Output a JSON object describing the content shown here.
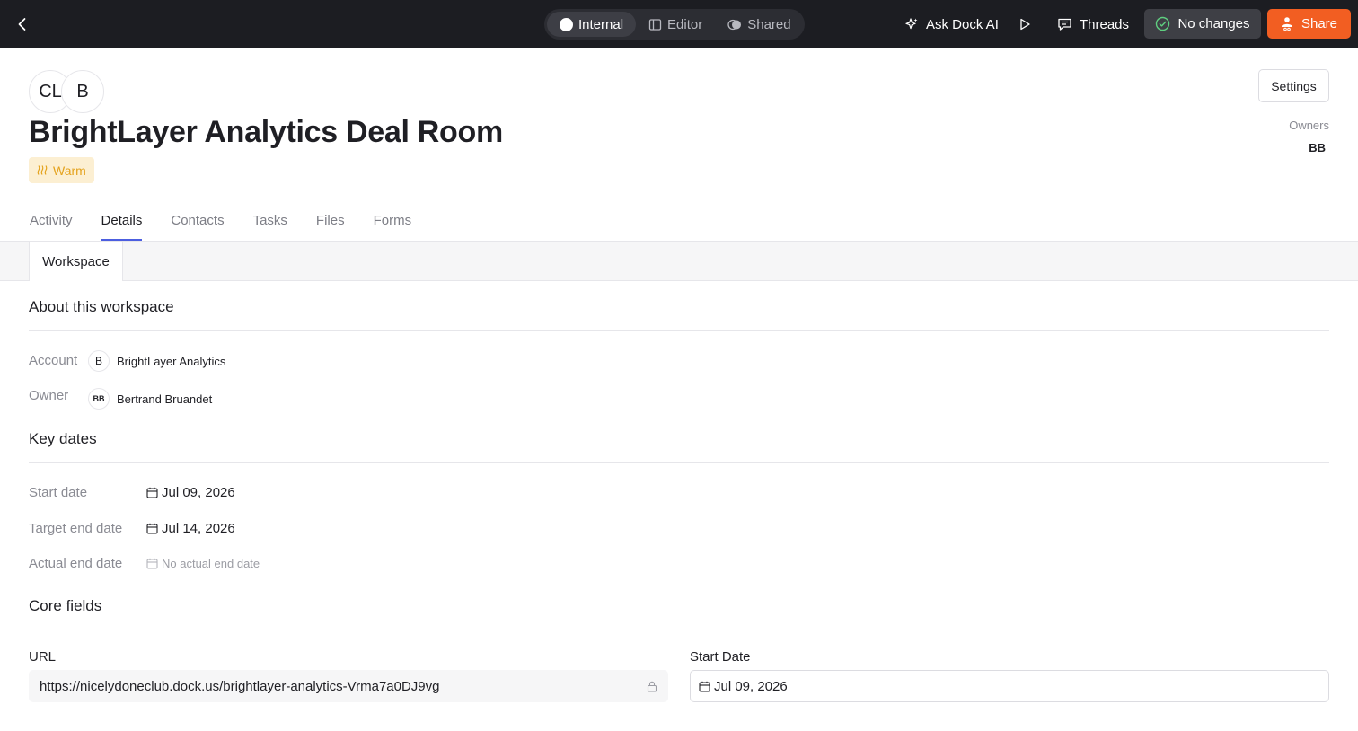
{
  "topbar": {
    "modes": [
      {
        "label": "Internal",
        "icon": "circle-dot-icon",
        "active": true
      },
      {
        "label": "Editor",
        "icon": "sidebar-panel-icon",
        "active": false
      },
      {
        "label": "Shared",
        "icon": "toggle-icon",
        "active": false
      }
    ],
    "ask_ai_label": "Ask Dock AI",
    "threads_label": "Threads",
    "no_changes_label": "No changes",
    "share_label": "Share",
    "colors": {
      "bar": "#1c1d22",
      "share": "#f25e22"
    }
  },
  "header": {
    "avatars": [
      "CL",
      "B"
    ],
    "title": "BrightLayer Analytics Deal Room",
    "status": "Warm",
    "status_color": "#e4a21c",
    "settings_label": "Settings",
    "owners_label": "Owners",
    "owners_initials": "BB"
  },
  "tabs": [
    {
      "label": "Activity",
      "active": false
    },
    {
      "label": "Details",
      "active": true
    },
    {
      "label": "Contacts",
      "active": false
    },
    {
      "label": "Tasks",
      "active": false
    },
    {
      "label": "Files",
      "active": false
    },
    {
      "label": "Forms",
      "active": false
    }
  ],
  "subtabs": [
    {
      "label": "Workspace",
      "active": true
    }
  ],
  "about": {
    "title": "About this workspace",
    "account_label": "Account",
    "account_avatar": "B",
    "account_value": "BrightLayer Analytics",
    "owner_label": "Owner",
    "owner_avatar": "BB",
    "owner_value": "Bertrand Bruandet"
  },
  "key_dates": {
    "title": "Key dates",
    "start_label": "Start date",
    "start_value": "Jul 09, 2026",
    "target_label": "Target end date",
    "target_value": "Jul 14, 2026",
    "actual_label": "Actual end date",
    "actual_value": "No actual end date"
  },
  "core_fields": {
    "title": "Core fields",
    "url_label": "URL",
    "url_value": "https://nicelydoneclub.dock.us/brightlayer-analytics-Vrma7a0DJ9vg",
    "start_date_label": "Start Date",
    "start_date_value": "Jul 09, 2026"
  }
}
